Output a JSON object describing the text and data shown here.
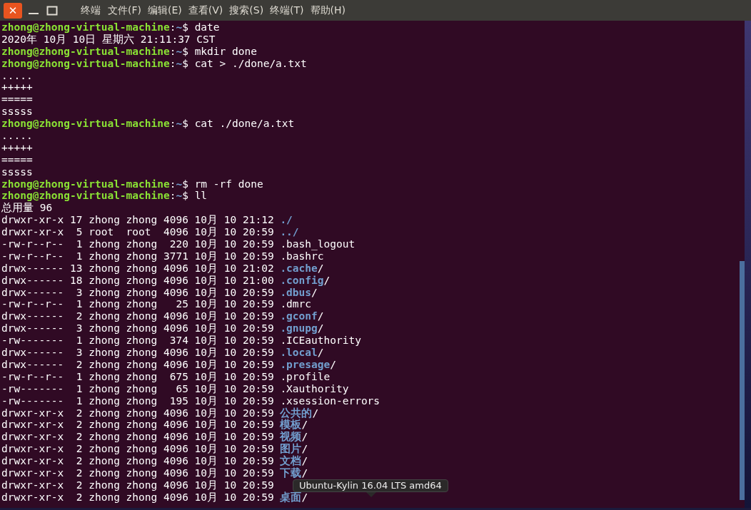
{
  "window": {
    "close": "✕",
    "title": "终端",
    "menu": [
      "文件(F)",
      "编辑(E)",
      "查看(V)",
      "搜索(S)",
      "终端(T)",
      "帮助(H)"
    ]
  },
  "terminal": {
    "lines": [
      {
        "kind": "prompt",
        "user": "zhong@zhong-virtual-machine",
        "sep": ":",
        "path": "~",
        "symbol": "$",
        "command": "date"
      },
      {
        "kind": "output",
        "text": "2020年 10月 10日 星期六 21:11:37 CST"
      },
      {
        "kind": "prompt",
        "user": "zhong@zhong-virtual-machine",
        "sep": ":",
        "path": "~",
        "symbol": "$",
        "command": "mkdir done"
      },
      {
        "kind": "prompt",
        "user": "zhong@zhong-virtual-machine",
        "sep": ":",
        "path": "~",
        "symbol": "$",
        "command": "cat > ./done/a.txt"
      },
      {
        "kind": "output",
        "text": "....."
      },
      {
        "kind": "output",
        "text": "+++++"
      },
      {
        "kind": "output",
        "text": "====="
      },
      {
        "kind": "output",
        "text": "sssss"
      },
      {
        "kind": "prompt",
        "user": "zhong@zhong-virtual-machine",
        "sep": ":",
        "path": "~",
        "symbol": "$",
        "command": "cat ./done/a.txt"
      },
      {
        "kind": "output",
        "text": "....."
      },
      {
        "kind": "output",
        "text": "+++++"
      },
      {
        "kind": "output",
        "text": "====="
      },
      {
        "kind": "output",
        "text": "sssss"
      },
      {
        "kind": "prompt",
        "user": "zhong@zhong-virtual-machine",
        "sep": ":",
        "path": "~",
        "symbol": "$",
        "command": "rm -rf done"
      },
      {
        "kind": "prompt",
        "user": "zhong@zhong-virtual-machine",
        "sep": ":",
        "path": "~",
        "symbol": "$",
        "command": "ll"
      },
      {
        "kind": "output",
        "text": "总用量 96"
      },
      {
        "kind": "listing",
        "info": "drwxr-xr-x 17 zhong zhong 4096 10月 10 21:12",
        "name": "./",
        "is_dir": true
      },
      {
        "kind": "listing",
        "info": "drwxr-xr-x  5 root  root  4096 10月 10 20:59",
        "name": "../",
        "is_dir": true
      },
      {
        "kind": "listing",
        "info": "-rw-r--r--  1 zhong zhong  220 10月 10 20:59",
        "name": ".bash_logout",
        "is_dir": false
      },
      {
        "kind": "listing",
        "info": "-rw-r--r--  1 zhong zhong 3771 10月 10 20:59",
        "name": ".bashrc",
        "is_dir": false
      },
      {
        "kind": "listing",
        "info": "drwx------ 13 zhong zhong 4096 10月 10 21:02",
        "name": ".cache",
        "suffix": "/",
        "is_dir": true
      },
      {
        "kind": "listing",
        "info": "drwx------ 18 zhong zhong 4096 10月 10 21:00",
        "name": ".config",
        "suffix": "/",
        "is_dir": true
      },
      {
        "kind": "listing",
        "info": "drwx------  3 zhong zhong 4096 10月 10 20:59",
        "name": ".dbus",
        "suffix": "/",
        "is_dir": true
      },
      {
        "kind": "listing",
        "info": "-rw-r--r--  1 zhong zhong   25 10月 10 20:59",
        "name": ".dmrc",
        "is_dir": false
      },
      {
        "kind": "listing",
        "info": "drwx------  2 zhong zhong 4096 10月 10 20:59",
        "name": ".gconf",
        "suffix": "/",
        "is_dir": true
      },
      {
        "kind": "listing",
        "info": "drwx------  3 zhong zhong 4096 10月 10 20:59",
        "name": ".gnupg",
        "suffix": "/",
        "is_dir": true
      },
      {
        "kind": "listing",
        "info": "-rw-------  1 zhong zhong  374 10月 10 20:59",
        "name": ".ICEauthority",
        "is_dir": false
      },
      {
        "kind": "listing",
        "info": "drwx------  3 zhong zhong 4096 10月 10 20:59",
        "name": ".local",
        "suffix": "/",
        "is_dir": true
      },
      {
        "kind": "listing",
        "info": "drwx------  2 zhong zhong 4096 10月 10 20:59",
        "name": ".presage",
        "suffix": "/",
        "is_dir": true
      },
      {
        "kind": "listing",
        "info": "-rw-r--r--  1 zhong zhong  675 10月 10 20:59",
        "name": ".profile",
        "is_dir": false
      },
      {
        "kind": "listing",
        "info": "-rw-------  1 zhong zhong   65 10月 10 20:59",
        "name": ".Xauthority",
        "is_dir": false
      },
      {
        "kind": "listing",
        "info": "-rw-------  1 zhong zhong  195 10月 10 20:59",
        "name": ".xsession-errors",
        "is_dir": false
      },
      {
        "kind": "listing",
        "info": "drwxr-xr-x  2 zhong zhong 4096 10月 10 20:59",
        "name": "公共的",
        "suffix": "/",
        "is_dir": true
      },
      {
        "kind": "listing",
        "info": "drwxr-xr-x  2 zhong zhong 4096 10月 10 20:59",
        "name": "模板",
        "suffix": "/",
        "is_dir": true
      },
      {
        "kind": "listing",
        "info": "drwxr-xr-x  2 zhong zhong 4096 10月 10 20:59",
        "name": "视频",
        "suffix": "/",
        "is_dir": true
      },
      {
        "kind": "listing",
        "info": "drwxr-xr-x  2 zhong zhong 4096 10月 10 20:59",
        "name": "图片",
        "suffix": "/",
        "is_dir": true
      },
      {
        "kind": "listing",
        "info": "drwxr-xr-x  2 zhong zhong 4096 10月 10 20:59",
        "name": "文档",
        "suffix": "/",
        "is_dir": true
      },
      {
        "kind": "listing",
        "info": "drwxr-xr-x  2 zhong zhong 4096 10月 10 20:59",
        "name": "下载",
        "suffix": "/",
        "is_dir": true
      },
      {
        "kind": "listing",
        "info": "drwxr-xr-x  2 zhong zhong 4096 10月 10 20:59"
      },
      {
        "kind": "listing",
        "info": "drwxr-xr-x  2 zhong zhong 4096 10月 10 20:59",
        "name": "桌面",
        "suffix": "/",
        "is_dir": true
      }
    ]
  },
  "tooltip": {
    "text": "Ubuntu-Kylin 16.04 LTS amd64"
  }
}
